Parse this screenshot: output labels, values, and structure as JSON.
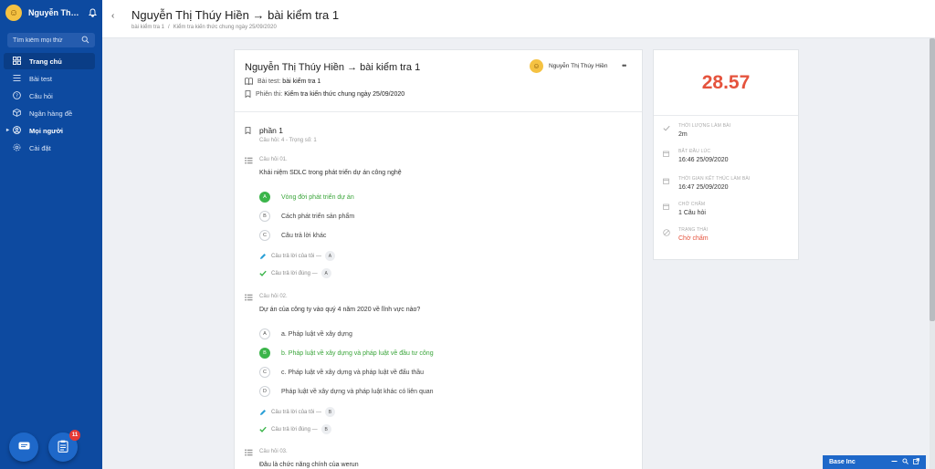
{
  "sidebar": {
    "user_name": "Nguyễn Thị Thúy Hiền",
    "search_placeholder": "Tìm kiếm mọi thứ",
    "items": [
      {
        "label": "Trang chủ"
      },
      {
        "label": "Bài test"
      },
      {
        "label": "Câu hỏi"
      },
      {
        "label": "Ngân hàng đề"
      },
      {
        "label": "Mọi người"
      },
      {
        "label": "Cài đặt"
      }
    ],
    "task_badge": "11"
  },
  "header": {
    "title": "Nguyễn Thị Thúy Hiền → bài kiểm tra 1",
    "breadcrumb": [
      "bài kiểm tra 1",
      "Kiểm tra kiến thức chung ngày 25/09/2020"
    ]
  },
  "card": {
    "title": "Nguyễn Thị Thúy Hiền → bài kiểm tra 1",
    "author": "Nguyễn Thị Thúy Hiền",
    "test_label": "Bài test:",
    "test_value": "bài kiểm tra 1",
    "session_label": "Phiên thi:",
    "session_value": "Kiểm tra kiến thức chung ngày 25/09/2020",
    "section_title": "phần 1",
    "section_sub": "Câu hỏi: 4 - Trọng số: 1",
    "my_answer_label": "Câu trả lời của tôi —",
    "correct_answer_label": "Câu trả lời đúng —",
    "questions": [
      {
        "num": "Câu hỏi 01.",
        "text": "Khái niệm SDLC trong phát triển dự án công nghệ",
        "options": [
          {
            "letter": "A",
            "text": "Vòng đời phát triển dự án"
          },
          {
            "letter": "B",
            "text": "Cách phát triển sản phẩm"
          },
          {
            "letter": "C",
            "text": "Câu trả lời khác"
          }
        ],
        "my_answer": "A",
        "correct_answer": "A"
      },
      {
        "num": "Câu hỏi 02.",
        "text": "Dự án của công ty vào quý 4 năm 2020 về lĩnh vực nào?",
        "options": [
          {
            "letter": "A",
            "text": "a. Pháp luật về xây dựng"
          },
          {
            "letter": "B",
            "text": "b. Pháp luật về xây dựng và pháp luật về đầu tư công"
          },
          {
            "letter": "C",
            "text": "c. Pháp luật về xây dựng và pháp luật về đấu thầu"
          },
          {
            "letter": "D",
            "text": "Pháp luật về xây dựng và pháp luật khác có liên quan"
          }
        ],
        "my_answer": "B",
        "correct_answer": "B"
      },
      {
        "num": "Câu hỏi 03.",
        "text": "Đâu là chức năng chính của werun"
      }
    ]
  },
  "panel": {
    "score": "28.57",
    "stats": [
      {
        "label": "Thời lượng làm bài",
        "value": "2m"
      },
      {
        "label": "Bắt đầu lúc",
        "value": "16:46 25/09/2020"
      },
      {
        "label": "Thời gian kết thúc làm bài",
        "value": "16:47 25/09/2020"
      },
      {
        "label": "Chờ chấm",
        "value": "1 Câu hỏi"
      },
      {
        "label": "Trạng thái",
        "value": "Chờ chấm"
      }
    ]
  },
  "chat": {
    "label": "Base Inc"
  },
  "colors": {
    "sidebar": "#0d4aa0",
    "score": "#e5533d",
    "correct": "#3bb54a"
  }
}
